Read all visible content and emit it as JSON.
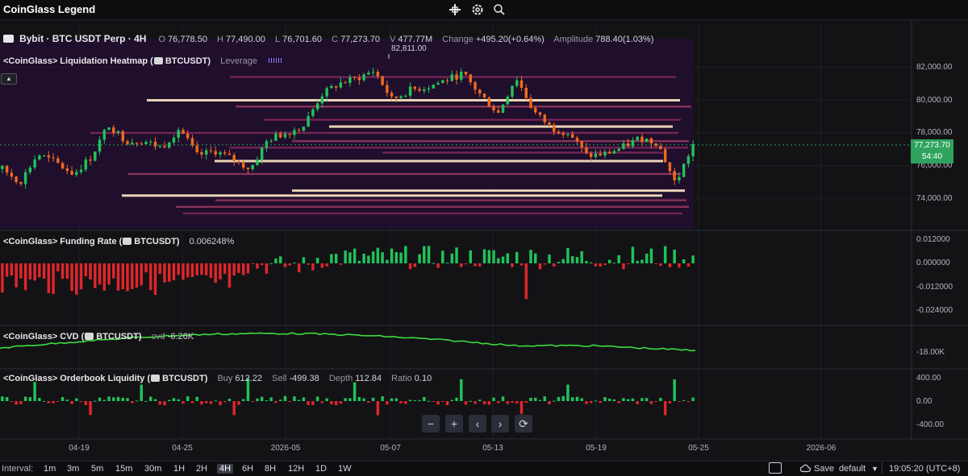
{
  "header": {
    "title": "CoinGlass Legend",
    "icons": [
      "crosshair-plus-icon",
      "settings-gear-icon",
      "search-icon"
    ]
  },
  "symbol": {
    "name": "Bybit · BTC USDT Perp · 4H",
    "open_label": "O",
    "open": "76,778.50",
    "high_label": "H",
    "high": "77,490.00",
    "low_label": "L",
    "low": "76,701.60",
    "close_label": "C",
    "close": "77,273.70",
    "volume_label": "V",
    "volume": "477.77M",
    "change_label": "Change",
    "change": "+495.20(+0.64%)",
    "amplitude_label": "Amplitude",
    "amplitude": "788.40(1.03%)"
  },
  "indicators": {
    "heatmap": {
      "title": "<CoinGlass> Liquidation Heatmap (",
      "symbol": "BTCUSDT",
      "close": ")",
      "param": "Leverage"
    },
    "funding": {
      "title": "<CoinGlass> Funding Rate (",
      "symbol": "BTCUSDT",
      "close": ")",
      "value": "0.006248%"
    },
    "cvd": {
      "title": "<CoinGlass> CVD (",
      "symbol": "BTCUSDT",
      "close": ")",
      "param": "cvd",
      "value": "-6.26K"
    },
    "orderbook": {
      "title": "<CoinGlass> Orderbook Liquidity (",
      "symbol": "BTCUSDT",
      "close": ")",
      "buy_label": "Buy",
      "buy": "612.22",
      "sell_label": "Sell",
      "sell": "-499.38",
      "depth_label": "Depth",
      "depth": "112.84",
      "ratio_label": "Ratio",
      "ratio": "0.10"
    }
  },
  "price_axis": {
    "main": [
      "82,000.00",
      "80,000.00",
      "78,000.00",
      "76,000.00",
      "74,000.00"
    ],
    "current_price": "77,273.70",
    "countdown": "54:40",
    "high_marker": "82,811.00",
    "funding": [
      "0.012000",
      "0.000000",
      "-0.012000",
      "-0.024000"
    ],
    "cvd": [
      "-18.00K"
    ],
    "orderbook": [
      "400.00",
      "0.00",
      "-400.00"
    ]
  },
  "time_axis": [
    "04-19",
    "04-25",
    "2026-05",
    "05-07",
    "05-13",
    "05-19",
    "05-25",
    "2026-06"
  ],
  "nav_buttons": [
    "−",
    "+",
    "‹",
    "›",
    "⟳"
  ],
  "toolbar": {
    "interval_label": "Interval:",
    "intervals": [
      "1m",
      "3m",
      "5m",
      "15m",
      "30m",
      "1H",
      "2H",
      "4H",
      "6H",
      "8H",
      "12H",
      "1D",
      "1W"
    ],
    "active_interval": "4H",
    "save_label": "Save",
    "layout_name": "default",
    "clock": "19:05:20 (UTC+8)"
  },
  "colors": {
    "background": "#131316",
    "candle_up": "#21c35a",
    "candle_down": "#ef6a1f",
    "funding_up": "#21c35a",
    "funding_down": "#e0262b",
    "cvd_line": "#3cdc3c",
    "price_tag": "#2fa35d",
    "heatmap_base": "#2a0b40"
  },
  "chart_data": {
    "type": "candlestick",
    "timeframe": "4H",
    "ohlc_last": {
      "open": 76778.5,
      "high": 77490.0,
      "low": 76701.6,
      "close": 77273.7
    },
    "price_range": [
      73000,
      83200
    ],
    "max_high": 82811,
    "close_path": [
      [
        "04-16",
        75800
      ],
      [
        "04-17",
        75000
      ],
      [
        "04-18",
        76700
      ],
      [
        "04-19",
        76200
      ],
      [
        "04-20",
        75500
      ],
      [
        "04-21",
        76500
      ],
      [
        "04-22",
        78500
      ],
      [
        "04-23",
        77500
      ],
      [
        "04-24",
        77500
      ],
      [
        "04-25",
        77100
      ],
      [
        "04-26",
        78300
      ],
      [
        "04-27",
        76600
      ],
      [
        "04-28",
        76900
      ],
      [
        "04-29",
        76400
      ],
      [
        "04-30",
        75800
      ],
      [
        "05-01",
        77600
      ],
      [
        "05-02",
        78000
      ],
      [
        "05-03",
        78400
      ],
      [
        "05-04",
        80300
      ],
      [
        "05-05",
        81000
      ],
      [
        "05-06",
        81300
      ],
      [
        "05-07",
        81800
      ],
      [
        "05-08",
        80000
      ],
      [
        "05-09",
        80600
      ],
      [
        "05-10",
        80800
      ],
      [
        "05-11",
        81200
      ],
      [
        "05-12",
        81600
      ],
      [
        "05-13",
        80300
      ],
      [
        "05-14",
        79200
      ],
      [
        "05-15",
        81400
      ],
      [
        "05-16",
        79300
      ],
      [
        "05-17",
        78300
      ],
      [
        "05-18",
        78000
      ],
      [
        "05-19",
        76600
      ],
      [
        "05-20",
        76700
      ],
      [
        "05-21",
        77100
      ],
      [
        "05-22",
        77700
      ],
      [
        "05-23",
        77400
      ],
      [
        "05-24",
        74900
      ],
      [
        "05-25",
        77274
      ]
    ],
    "liquidation_levels": [
      81400,
      80000,
      79600,
      78800,
      78400,
      78000,
      77500,
      77100,
      76800,
      76300,
      75500,
      74500,
      74200,
      73900,
      73500,
      73100
    ],
    "funding_range": [
      -0.024,
      0.012
    ],
    "orderbook_range": [
      -400,
      400
    ],
    "cvd_last": -6.26
  }
}
